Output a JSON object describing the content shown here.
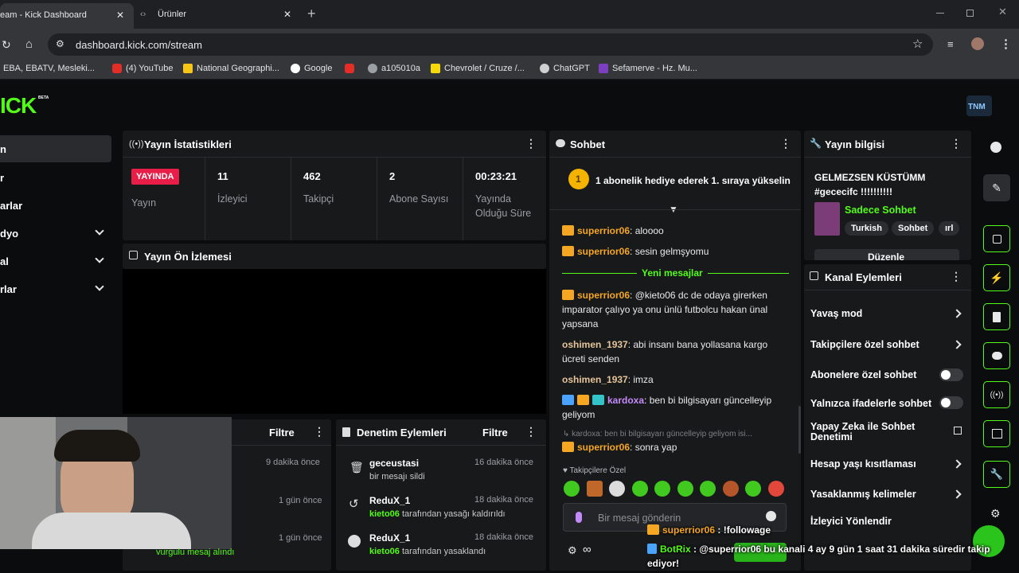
{
  "browser": {
    "tabs": [
      {
        "label": "eam - Kick Dashboard",
        "close": "✕"
      },
      {
        "label": "Ürünler",
        "close": "✕"
      }
    ],
    "new_tab": "+",
    "url": "dashboard.kick.com/stream",
    "bookmarks": [
      "EBA, EBATV, Mesleki...",
      "(4) YouTube",
      "National Geographi...",
      "Google",
      "a105010a",
      "Chevrolet / Cruze /...",
      "ChatGPT",
      "Sefamerve - Hz. Mu..."
    ]
  },
  "kick": {
    "logo": "ICK",
    "beta": "BETA",
    "avatar_text": "TNM",
    "sidebar": [
      {
        "label": "n",
        "chevron": false
      },
      {
        "label": "r",
        "chevron": false
      },
      {
        "label": "arlar",
        "chevron": false
      },
      {
        "label": "dyo",
        "chevron": true
      },
      {
        "label": "al",
        "chevron": true
      },
      {
        "label": "rlar",
        "chevron": true
      }
    ]
  },
  "stats": {
    "title": "Yayın İstatistikleri",
    "live_badge": "YAYINDA",
    "live_label": "Yayın",
    "items": [
      {
        "value": "11",
        "label": "İzleyici"
      },
      {
        "value": "462",
        "label": "Takipçi"
      },
      {
        "value": "2",
        "label": "Abone Sayısı"
      },
      {
        "value": "00:23:21",
        "label": "Yayında Olduğu Süre"
      }
    ]
  },
  "preview": {
    "title": "Yayın Ön İzlemesi"
  },
  "activity": {
    "filter": "Filtre",
    "times": [
      "9 dakika önce",
      "1 gün önce",
      "1 gün önce"
    ],
    "overlay_text": "vurgulu mesaj alındı"
  },
  "moderation": {
    "title": "Denetim Eylemleri",
    "filter": "Filtre",
    "items": [
      {
        "user": "geceustasi",
        "desc": "bir mesajı sildi",
        "actor": "",
        "time": "16 dakika önce"
      },
      {
        "user": "ReduX_1",
        "actor": "kieto06",
        "desc": "tarafından yasağı kaldırıldı",
        "time": "18 dakika önce"
      },
      {
        "user": "ReduX_1",
        "actor": "kieto06",
        "desc": "tarafından yasaklandı",
        "time": "18 dakika önce"
      }
    ]
  },
  "chat": {
    "title": "Sohbet",
    "gift_rank": "1",
    "gift_text": "1 abonelik hediye ederek 1. sıraya yükselin",
    "new_messages": "Yeni mesajlar",
    "messages": [
      {
        "user": "superrior06",
        "text": ": aloooo"
      },
      {
        "user": "superrior06",
        "text": ": sesin gelmşyomu"
      },
      {
        "user": "superrior06",
        "text": ": @kieto06 dc de odaya girerken imparator çalıyo ya onu ünlü futbolcu hakan ünal yapsana"
      },
      {
        "user": "oshimen_1937",
        "text": ": abi insanı bana yollasana kargo ücreti senden"
      },
      {
        "user": "oshimen_1937",
        "text": ": imza"
      },
      {
        "user": "kardoxa",
        "text": ": ben bi bilgisayarı güncelleyip geliyom"
      },
      {
        "user": "superrior06",
        "text": ": sonra yap"
      }
    ],
    "reply_preview": "kardoxa: ben bi bilgisayarı güncelleyip geliyom isi...",
    "followers_only": "Takipçilere Özel",
    "input_placeholder": "Bir mesaj gönderin"
  },
  "stream_info": {
    "title": "Yayın bilgisi",
    "stream_title": "GELMEZSEN KÜSTÜMM #gececifc !!!!!!!!!!",
    "category": "Sadece Sohbet",
    "tags": [
      "Turkish",
      "Sohbet",
      "ırl"
    ],
    "edit": "Düzenle"
  },
  "channel_actions": {
    "title": "Kanal Eylemleri",
    "items": [
      {
        "label": "Yavaş mod",
        "control": "chevron"
      },
      {
        "label": "Takipçilere özel sohbet",
        "control": "chevron"
      },
      {
        "label": "Abonelere özel sohbet",
        "control": "toggle"
      },
      {
        "label": "Yalnızca ifadelerle sohbet",
        "control": "toggle"
      },
      {
        "label": "Yapay Zeka ile Sohbet Denetimi",
        "control": "external"
      },
      {
        "label": "Hesap yaşı kısıtlaması",
        "control": "chevron"
      },
      {
        "label": "Yasaklanmış kelimeler",
        "control": "chevron"
      },
      {
        "label": "İzleyici Yönlendir",
        "control": ""
      }
    ]
  },
  "overlay": {
    "line1_user": "superrior06",
    "line1_text": " : !followage",
    "line2_user": "BotRix",
    "line2_text": " : @superrior06 bu kanali 4 ay 9 gün 1 saat 31 dakika süredir takip ediyor!"
  },
  "colors": {
    "accent": "#53fc18",
    "live": "#e91e48",
    "panel": "#18191b",
    "gold": "#f5a623"
  }
}
